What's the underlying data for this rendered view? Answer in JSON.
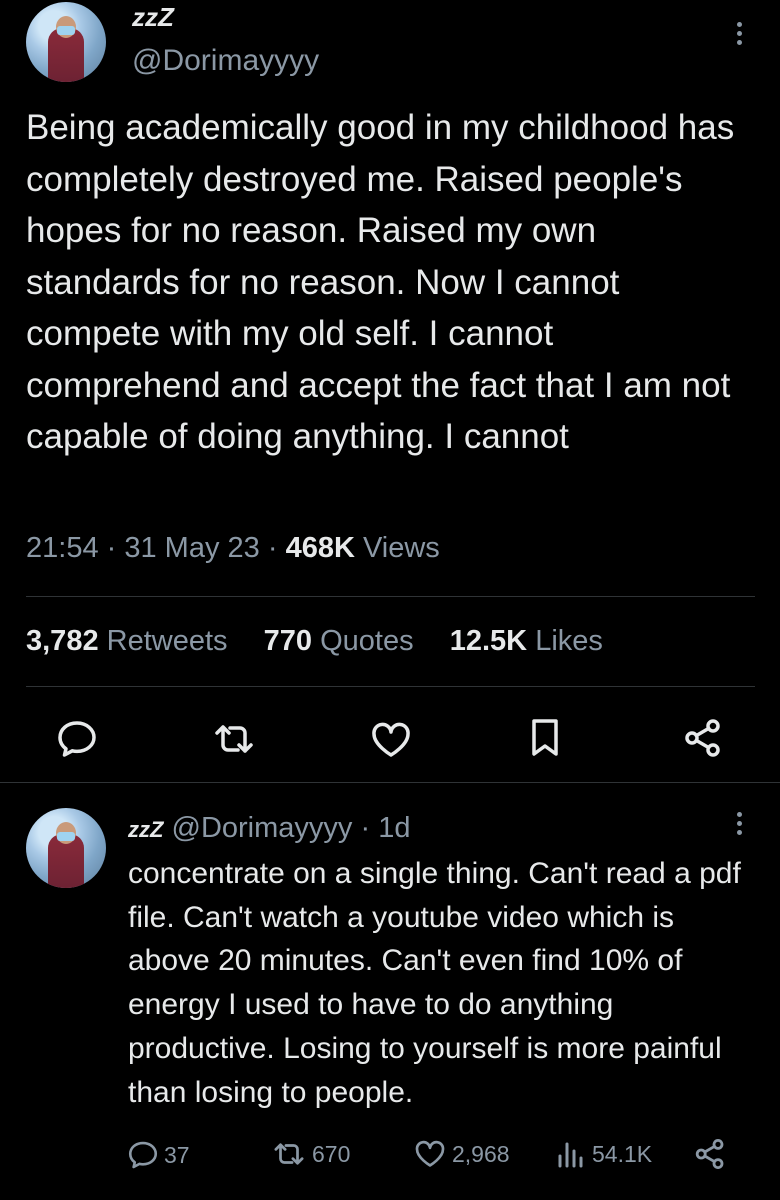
{
  "main_tweet": {
    "sleep_symbol": "zzZ",
    "handle": "@Dorimayyyy",
    "text": "Being academically good in my childhood has completely destroyed me. Raised people's hopes for no reason. Raised my own standards for no reason. Now I cannot compete with my old self. I cannot comprehend and accept the fact that I am not capable of doing anything. I cannot",
    "time": "21:54",
    "date": "31 May 23",
    "views_count": "468K",
    "views_label": "Views",
    "retweets_count": "3,782",
    "retweets_label": "Retweets",
    "quotes_count": "770",
    "quotes_label": "Quotes",
    "likes_count": "12.5K",
    "likes_label": "Likes"
  },
  "reply_tweet": {
    "sleep_symbol": "zzZ",
    "handle": "@Dorimayyyy",
    "age": "1d",
    "text": "concentrate on a single thing. Can't read a pdf file. Can't watch a youtube video which is above 20 minutes. Can't even find 10% of energy I used to have to do anything productive. Losing to yourself is more painful than losing to people.",
    "replies": "37",
    "retweets": "670",
    "likes": "2,968",
    "views": "54.1K"
  },
  "icons": [
    "reply-icon",
    "retweet-icon",
    "like-icon",
    "bookmark-icon",
    "share-icon",
    "views-icon",
    "more-icon"
  ],
  "colors": {
    "background": "#000000",
    "text": "#e7e9ea",
    "secondary": "#8b98a5",
    "divider": "#2f3336"
  }
}
